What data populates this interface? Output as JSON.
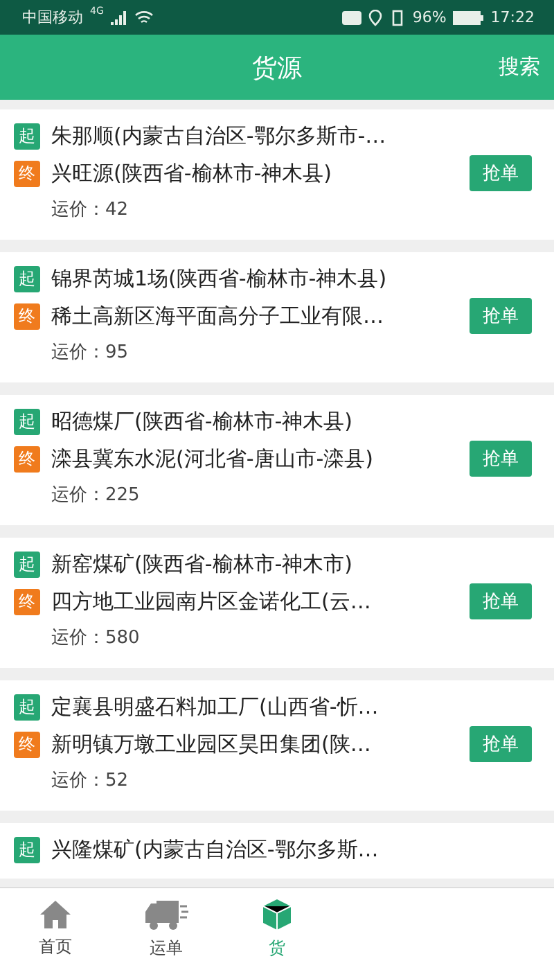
{
  "status_bar": {
    "carrier": "中国移动",
    "network": "4G",
    "battery_percent": "96%",
    "time": "17:22"
  },
  "header": {
    "title": "货源",
    "action": "搜索"
  },
  "cards": [
    {
      "start_badge": "起",
      "start": "朱那顺(内蒙古自治区-鄂尔多斯市-…",
      "end_badge": "终",
      "end": "兴旺源(陕西省-榆林市-神木县)",
      "price": "运价：42",
      "button": "抢单"
    },
    {
      "start_badge": "起",
      "start": "锦界芮城1场(陕西省-榆林市-神木县)",
      "end_badge": "终",
      "end": "稀土高新区海平面高分子工业有限…",
      "price": "运价：95",
      "button": "抢单"
    },
    {
      "start_badge": "起",
      "start": "昭德煤厂(陕西省-榆林市-神木县)",
      "end_badge": "终",
      "end": "滦县冀东水泥(河北省-唐山市-滦县)",
      "price": "运价：225",
      "button": "抢单"
    },
    {
      "start_badge": "起",
      "start": "新窑煤矿(陕西省-榆林市-神木市)",
      "end_badge": "终",
      "end": "四方地工业园南片区金诺化工(云…",
      "price": "运价：580",
      "button": "抢单"
    },
    {
      "start_badge": "起",
      "start": "定襄县明盛石料加工厂(山西省-忻…",
      "end_badge": "终",
      "end": "新明镇万墩工业园区昊田集团(陕…",
      "price": "运价：52",
      "button": "抢单"
    },
    {
      "start_badge": "起",
      "start": "兴隆煤矿(内蒙古自治区-鄂尔多斯…"
    }
  ],
  "tabs": [
    {
      "kind": "home",
      "label": "首页",
      "selected": false
    },
    {
      "kind": "truck",
      "label": "运单",
      "selected": false
    },
    {
      "kind": "box",
      "label": "货",
      "selected": true
    }
  ]
}
